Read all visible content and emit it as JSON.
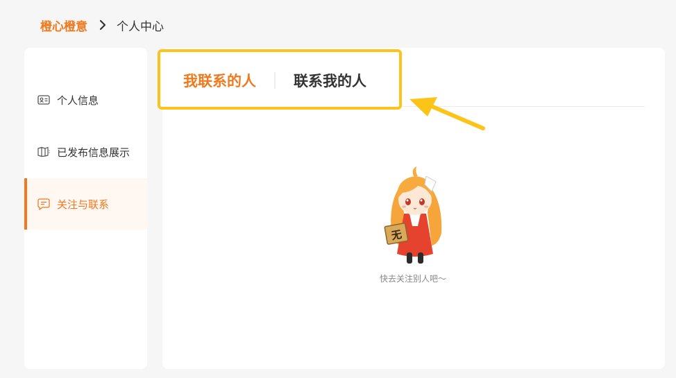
{
  "breadcrumb": {
    "home": "橙心橙意",
    "current": "个人中心"
  },
  "sidebar": {
    "items": [
      {
        "label": "个人信息",
        "icon": "id-card-icon",
        "active": false
      },
      {
        "label": "已发布信息展示",
        "icon": "brochure-icon",
        "active": false
      },
      {
        "label": "关注与联系",
        "icon": "message-icon",
        "active": true
      }
    ]
  },
  "tabs": [
    {
      "label": "我联系的人",
      "active": true
    },
    {
      "label": "联系我的人",
      "active": false
    }
  ],
  "empty_state": {
    "badge_text": "无",
    "message": "快去关注别人吧～"
  },
  "colors": {
    "accent": "#f0791d",
    "highlight": "#fcc419",
    "background": "#f6f6f6"
  }
}
